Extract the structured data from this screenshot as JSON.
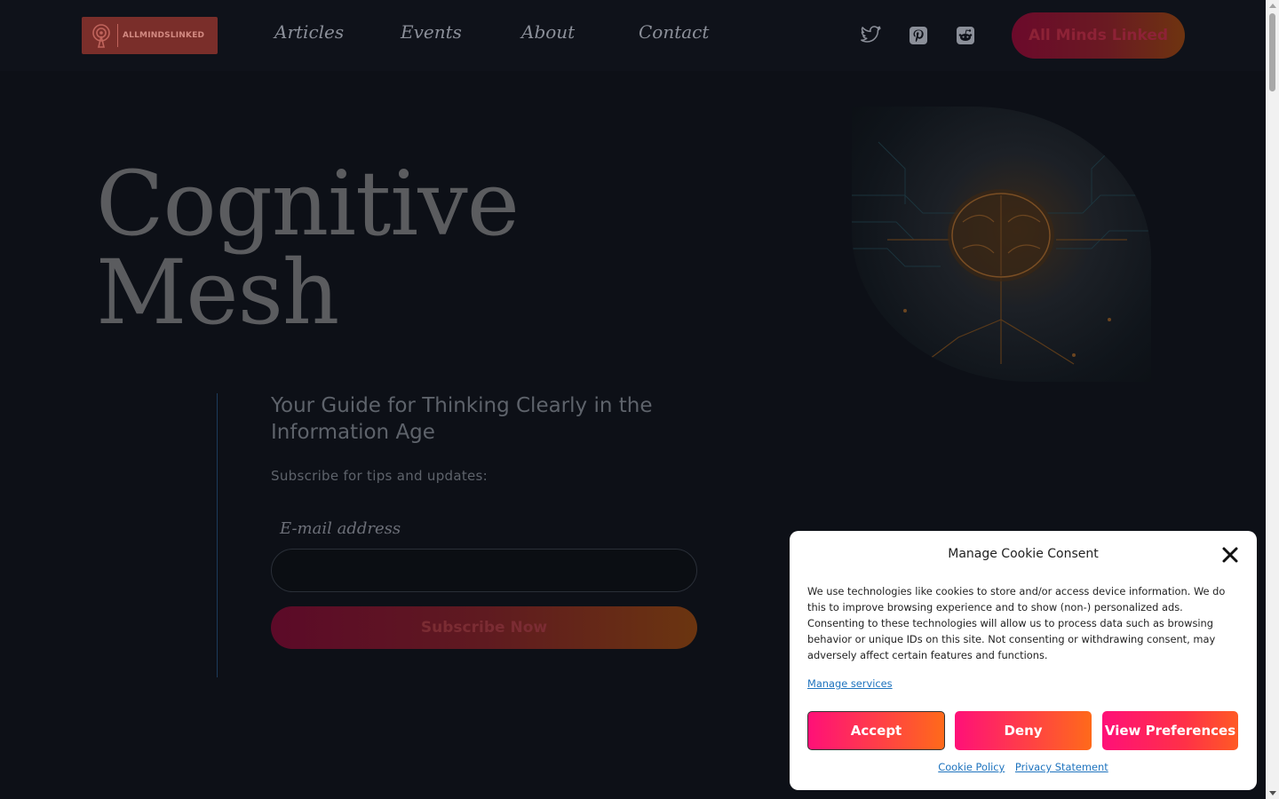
{
  "header": {
    "logo_text": "ALLMINDSLINKED",
    "nav": [
      "Articles",
      "Events",
      "About",
      "Contact"
    ],
    "social": [
      "twitter-icon",
      "pinterest-icon",
      "reddit-icon"
    ],
    "cta_label": "All Minds Linked"
  },
  "hero": {
    "title_line1": "Cognitive",
    "title_line2": "Mesh",
    "tagline": "Your Guide for Thinking Clearly in the Information Age",
    "subscribe_label": "Subscribe for tips and updates:",
    "email_label": "E-mail address",
    "email_value": "",
    "subscribe_button": "Subscribe Now"
  },
  "cookie": {
    "title": "Manage Cookie Consent",
    "body": "We use technologies like cookies to store and/or access device information. We do this to improve browsing experience and to show (non-) personalized ads. Consenting to these technologies will allow us to process data such as browsing behavior or unique IDs on this site. Not consenting or withdrawing consent, may adversely affect certain features and functions.",
    "manage_link": "Manage services",
    "accept": "Accept",
    "deny": "Deny",
    "preferences": "View Preferences",
    "cookie_policy": "Cookie Policy",
    "privacy_statement": "Privacy Statement"
  },
  "colors": {
    "background": "#0c0e14",
    "accent_start": "#ff1078",
    "accent_end": "#ff6a1a",
    "link": "#1e73be"
  }
}
